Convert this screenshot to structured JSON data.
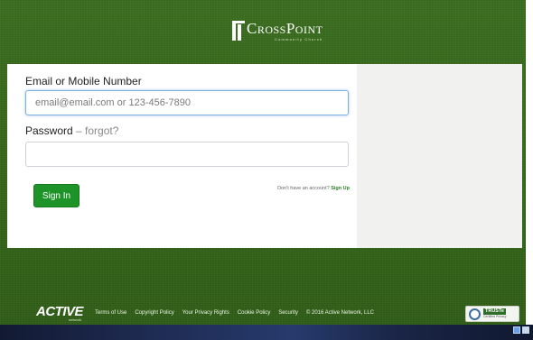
{
  "brand": {
    "name": "CrossPoint",
    "tagline": "Community Church"
  },
  "login": {
    "email_label": "Email or Mobile Number",
    "email_placeholder": "email@email.com or 123-456-7890",
    "email_value": "",
    "password_label": "Password",
    "password_separator": " – ",
    "forgot_link": "forgot?",
    "password_value": "",
    "signin_button": "Sign In",
    "signup_prompt": "Don't have an account?",
    "signup_link": "Sign Up"
  },
  "footer": {
    "active_logo": "ACTIVE",
    "active_sub": "network",
    "links": [
      "Terms of Use",
      "Copyright Policy",
      "Your Privacy Rights",
      "Cookie Policy",
      "Security"
    ],
    "copyright": "© 2016 Active Network, LLC",
    "truste": {
      "name": "TRUSTe",
      "sub": "Certified Privacy"
    }
  },
  "icons": {
    "logo": "crosspoint-logo-icon",
    "truste_seal": "truste-seal-icon",
    "tray": [
      "network-icon",
      "volume-icon"
    ]
  },
  "colors": {
    "background": "#356819",
    "primary_button": "#1e9428",
    "signup_link": "#2a7f24",
    "focus_border": "#7fb1e0"
  }
}
